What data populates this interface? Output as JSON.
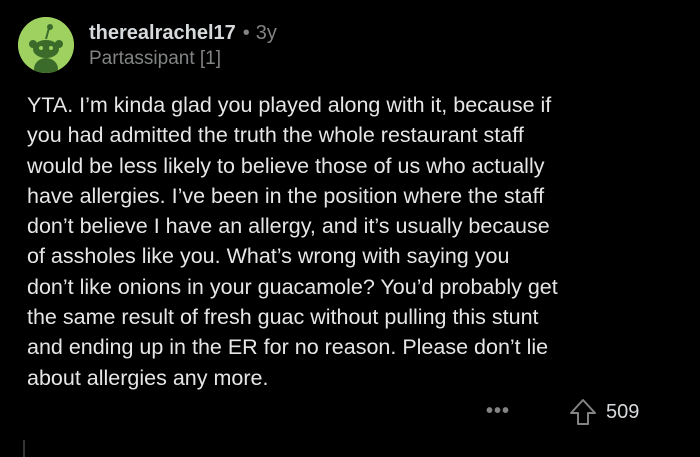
{
  "comment": {
    "author": "therealrachel17",
    "separator": "•",
    "age": "3y",
    "flair": "Partassipant [1]",
    "body_lines": [
      "YTA. I’m kinda glad you played along with it, because if",
      "you had admitted the truth the whole restaurant staff",
      "would be less likely to believe those of us who actually",
      "have allergies. I’ve been in the position where the staff",
      "don’t believe I have an allergy, and it’s usually because",
      "of assholes like you. What’s wrong with saying you",
      "don’t like onions in your guacamole? You’d probably get",
      "the same result of fresh guac without pulling this stunt",
      "and ending up in the ER for no reason. Please don’t lie",
      "about allergies any more."
    ],
    "more_label": "•••",
    "upvote_count": "509"
  },
  "icons": {
    "avatar": "reddit-snoo-avatar",
    "more": "more-options-icon",
    "upvote": "upvote-arrow-icon"
  },
  "colors": {
    "background": "#000000",
    "avatar_bg": "#9fd160",
    "text_primary": "#e6e6e6",
    "text_muted": "#818384"
  }
}
